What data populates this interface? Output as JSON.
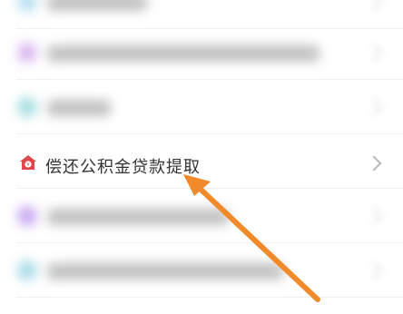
{
  "list": {
    "items": [
      {
        "label": "",
        "blurred": true
      },
      {
        "label": "",
        "blurred": true
      },
      {
        "label": "",
        "blurred": true
      },
      {
        "label": "偿还公积金贷款提取",
        "blurred": false,
        "icon": "house-loan-icon"
      },
      {
        "label": "",
        "blurred": true
      },
      {
        "label": "",
        "blurred": true
      }
    ]
  },
  "colors": {
    "accent_arrow": "#f08a2a",
    "icon_red": "#e0474c"
  }
}
